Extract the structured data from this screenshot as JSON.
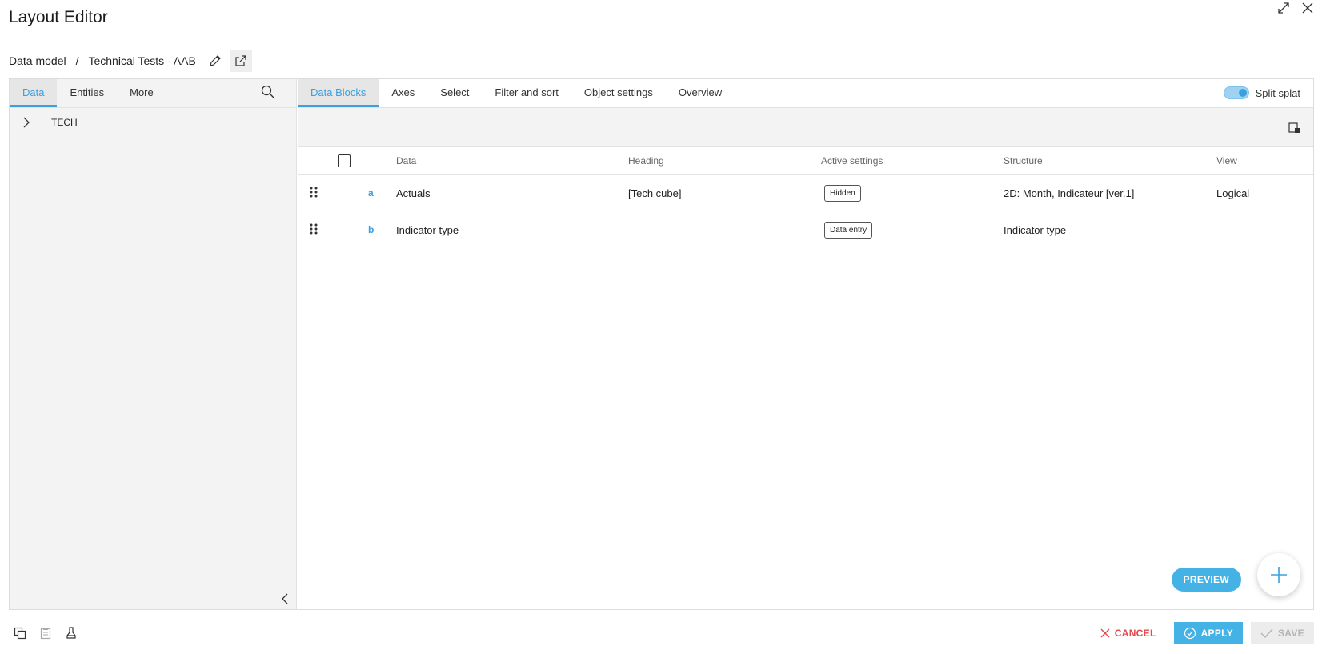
{
  "header": {
    "title": "Layout Editor"
  },
  "breadcrumb": {
    "root": "Data model",
    "separator": "/",
    "current": "Technical Tests - AAB"
  },
  "left_tabs": [
    {
      "label": "Data",
      "active": true
    },
    {
      "label": "Entities",
      "active": false
    },
    {
      "label": "More",
      "active": false
    }
  ],
  "tree": {
    "items": [
      {
        "label": "TECH"
      }
    ]
  },
  "right_tabs": [
    {
      "label": "Data Blocks",
      "active": true
    },
    {
      "label": "Axes",
      "active": false
    },
    {
      "label": "Select",
      "active": false
    },
    {
      "label": "Filter and sort",
      "active": false
    },
    {
      "label": "Object settings",
      "active": false
    },
    {
      "label": "Overview",
      "active": false
    }
  ],
  "split": {
    "label": "Split splat",
    "on": true
  },
  "table": {
    "columns": {
      "data": "Data",
      "heading": "Heading",
      "active": "Active settings",
      "structure": "Structure",
      "view": "View"
    },
    "rows": [
      {
        "letter": "a",
        "data": "Actuals",
        "heading": "[Tech cube]",
        "active": "Hidden",
        "structure": "2D: Month, Indicateur [ver.1]",
        "view": "Logical"
      },
      {
        "letter": "b",
        "data": "Indicator type",
        "heading": "",
        "active": "Data entry",
        "structure": "Indicator type",
        "view": ""
      }
    ]
  },
  "actions": {
    "preview": "PREVIEW",
    "cancel": "CANCEL",
    "apply": "APPLY",
    "save": "SAVE"
  },
  "colors": {
    "accent": "#3aa0de",
    "button": "#45b2e6",
    "danger": "#e5484d"
  }
}
